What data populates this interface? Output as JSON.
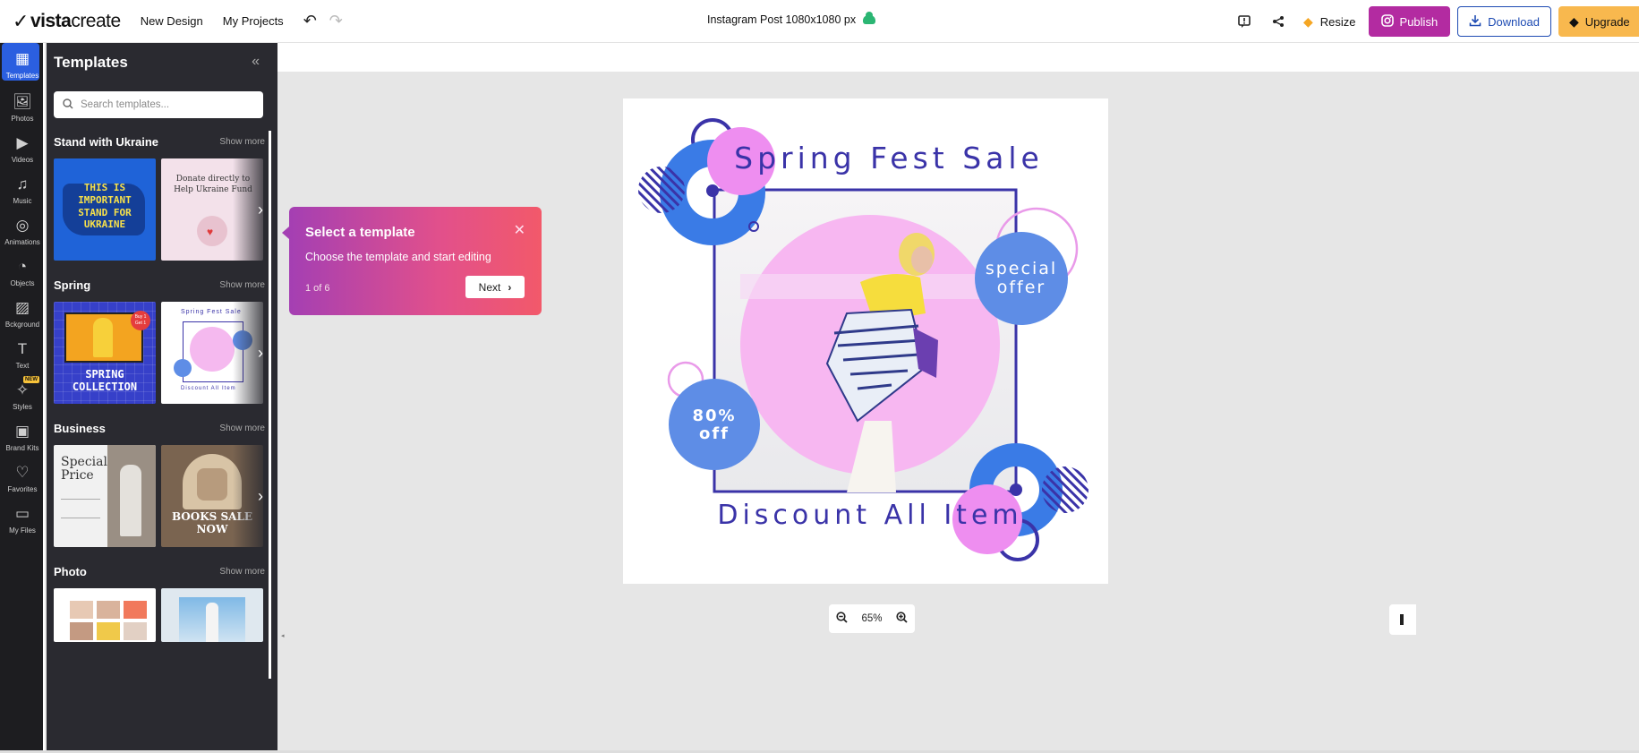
{
  "app": {
    "name_bold": "vista",
    "name_light": "create"
  },
  "header": {
    "new_design": "New Design",
    "my_projects": "My Projects",
    "doc_title": "Instagram Post 1080x1080 px",
    "resize": "Resize",
    "publish": "Publish",
    "download": "Download",
    "upgrade": "Upgrade"
  },
  "rail": [
    {
      "label": "Templates",
      "icon": "templates-icon"
    },
    {
      "label": "Photos",
      "icon": "photos-icon"
    },
    {
      "label": "Videos",
      "icon": "videos-icon"
    },
    {
      "label": "Music",
      "icon": "music-icon"
    },
    {
      "label": "Animations",
      "icon": "animations-icon"
    },
    {
      "label": "Objects",
      "icon": "objects-icon"
    },
    {
      "label": "Bckground",
      "icon": "background-icon"
    },
    {
      "label": "Text",
      "icon": "text-icon"
    },
    {
      "label": "Styles",
      "icon": "styles-icon",
      "badge": "NEW"
    },
    {
      "label": "Brand Kits",
      "icon": "brand-kits-icon"
    },
    {
      "label": "Favorites",
      "icon": "favorites-icon"
    },
    {
      "label": "My Files",
      "icon": "my-files-icon"
    }
  ],
  "panel": {
    "title": "Templates",
    "search_placeholder": "Search templates...",
    "sections": [
      {
        "title": "Stand with Ukraine",
        "more": "Show more",
        "thumbs": [
          {
            "text": "THIS IS IMPORTANT STAND FOR UKRAINE"
          },
          {
            "text": "Donate directly to Help Ukraine Fund"
          }
        ]
      },
      {
        "title": "Spring",
        "more": "Show more",
        "thumbs": [
          {
            "text": "SPRING COLLECTION",
            "badge": "Buy 1 Get 1"
          },
          {
            "text": "Spring Fest Sale",
            "sub": "Discount All Item"
          }
        ]
      },
      {
        "title": "Business",
        "more": "Show more",
        "thumbs": [
          {
            "text": "Special Price"
          },
          {
            "text": "BOOKS SALE NOW"
          }
        ]
      },
      {
        "title": "Photo",
        "more": "Show more",
        "thumbs": [
          {
            "text": ""
          },
          {
            "text": ""
          }
        ]
      }
    ]
  },
  "tooltip": {
    "title": "Select a template",
    "body": "Choose the template and start editing",
    "step": "1 of 6",
    "next": "Next"
  },
  "artboard": {
    "title": "Spring Fest Sale",
    "footer": "Discount All Item",
    "badge_offer_line1": "special",
    "badge_offer_line2": "offer",
    "badge_discount_line1": "80%",
    "badge_discount_line2": "off"
  },
  "zoom": {
    "level": "65%"
  },
  "colors": {
    "accent_blue": "#2b5fe0",
    "publish": "#b32ba1",
    "upgrade": "#f8b84e",
    "art_purple": "#3a33a8",
    "art_blue": "#3a7be6",
    "art_pink": "#ee8ef0"
  }
}
